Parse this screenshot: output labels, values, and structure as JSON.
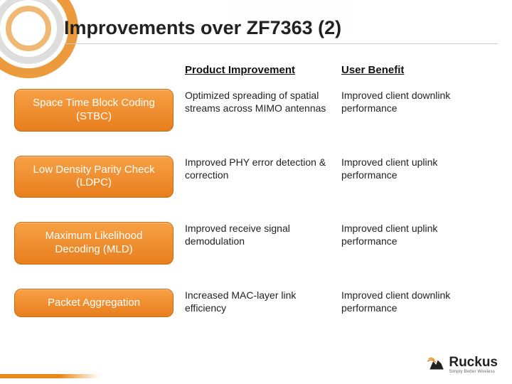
{
  "title": "Improvements over ZF7363 (2)",
  "columns": {
    "improvement": "Product Improvement",
    "benefit": "User Benefit"
  },
  "rows": [
    {
      "feature": "Space Time Block Coding (STBC)",
      "improvement": "Optimized spreading of spatial streams across MIMO antennas",
      "benefit": "Improved client downlink performance"
    },
    {
      "feature": "Low Density Parity Check (LDPC)",
      "improvement": "Improved PHY error detection & correction",
      "benefit": "Improved client uplink performance"
    },
    {
      "feature": "Maximum Likelihood Decoding (MLD)",
      "improvement": "Improved receive signal demodulation",
      "benefit": "Improved client uplink performance"
    },
    {
      "feature": "Packet Aggregation",
      "improvement": "Increased MAC-layer link efficiency",
      "benefit": "Improved client downlink performance"
    }
  ],
  "logo": {
    "name": "Ruckus",
    "tagline": "Simply Better Wireless"
  }
}
